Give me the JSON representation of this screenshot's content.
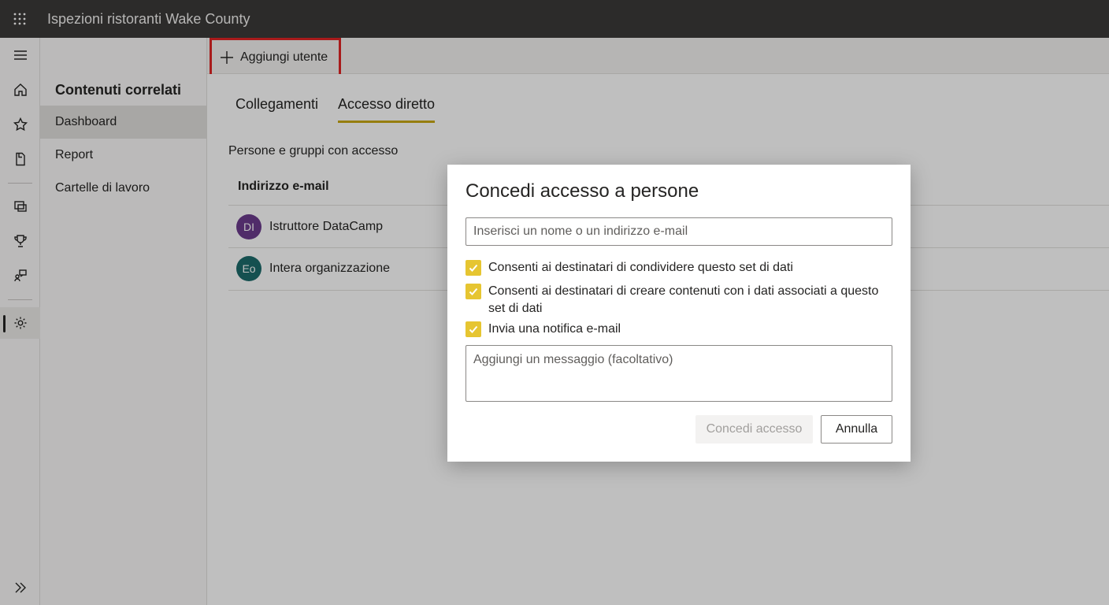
{
  "header": {
    "app_title": "Ispezioni ristoranti Wake County"
  },
  "rail": {
    "items": [
      "menu-icon",
      "home-icon",
      "star-icon",
      "document-icon",
      "workspace-icon",
      "trophy-icon",
      "learn-icon",
      "settings-icon"
    ],
    "expand_icon": "double-chevron-right-icon"
  },
  "leftnav": {
    "title": "Contenuti correlati",
    "items": [
      {
        "label": "Dashboard",
        "active": true
      },
      {
        "label": "Report",
        "active": false
      },
      {
        "label": "Cartelle di lavoro",
        "active": false
      }
    ]
  },
  "commandbar": {
    "add_user_label": "Aggiungi utente"
  },
  "tabs": [
    {
      "label": "Collegamenti",
      "selected": false
    },
    {
      "label": "Accesso diretto",
      "selected": true
    }
  ],
  "access": {
    "section_label": "Persone e gruppi con accesso",
    "column_header": "Indirizzo e-mail",
    "people": [
      {
        "initials": "DI",
        "name": "Istruttore DataCamp",
        "color": "#6b3b8c"
      },
      {
        "initials": "Eo",
        "name": "Intera organizzazione",
        "color": "#1c6b6b"
      }
    ]
  },
  "dialog": {
    "title": "Concedi accesso a persone",
    "email_placeholder": "Inserisci un nome o un indirizzo e-mail",
    "options": [
      {
        "label": "Consenti ai destinatari di condividere questo set di dati",
        "checked": true
      },
      {
        "label": "Consenti ai destinatari di creare contenuti con i dati associati a questo set di dati",
        "checked": true
      },
      {
        "label": "Invia una notifica e-mail",
        "checked": true
      }
    ],
    "message_placeholder": "Aggiungi un messaggio (facoltativo)",
    "grant_label": "Concedi accesso",
    "cancel_label": "Annulla"
  },
  "colors": {
    "accent": "#e6c531",
    "highlight_box": "#e02424",
    "topbar": "#3b3a39"
  }
}
